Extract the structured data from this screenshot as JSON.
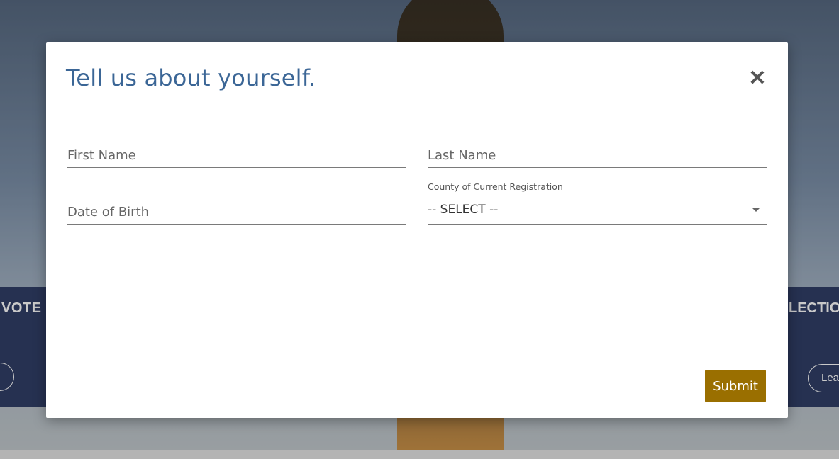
{
  "background": {
    "band_left_text": "VOTE",
    "band_right_text": "LECTIO",
    "band_right_button": "Lea"
  },
  "modal": {
    "title": "Tell us about yourself.",
    "close_symbol": "✕",
    "first_name": {
      "placeholder": "First Name",
      "value": ""
    },
    "last_name": {
      "placeholder": "Last Name",
      "value": ""
    },
    "date_of_birth": {
      "placeholder": "Date of Birth",
      "value": ""
    },
    "county": {
      "label": "County of Current Registration",
      "selected": "-- SELECT --"
    },
    "submit_label": "Submit"
  },
  "colors": {
    "title": "#3b6696",
    "submit": "#9a6f00",
    "band": "#26355f"
  },
  "icons": {
    "close": "close-icon",
    "dropdown": "chevron-down-icon"
  }
}
